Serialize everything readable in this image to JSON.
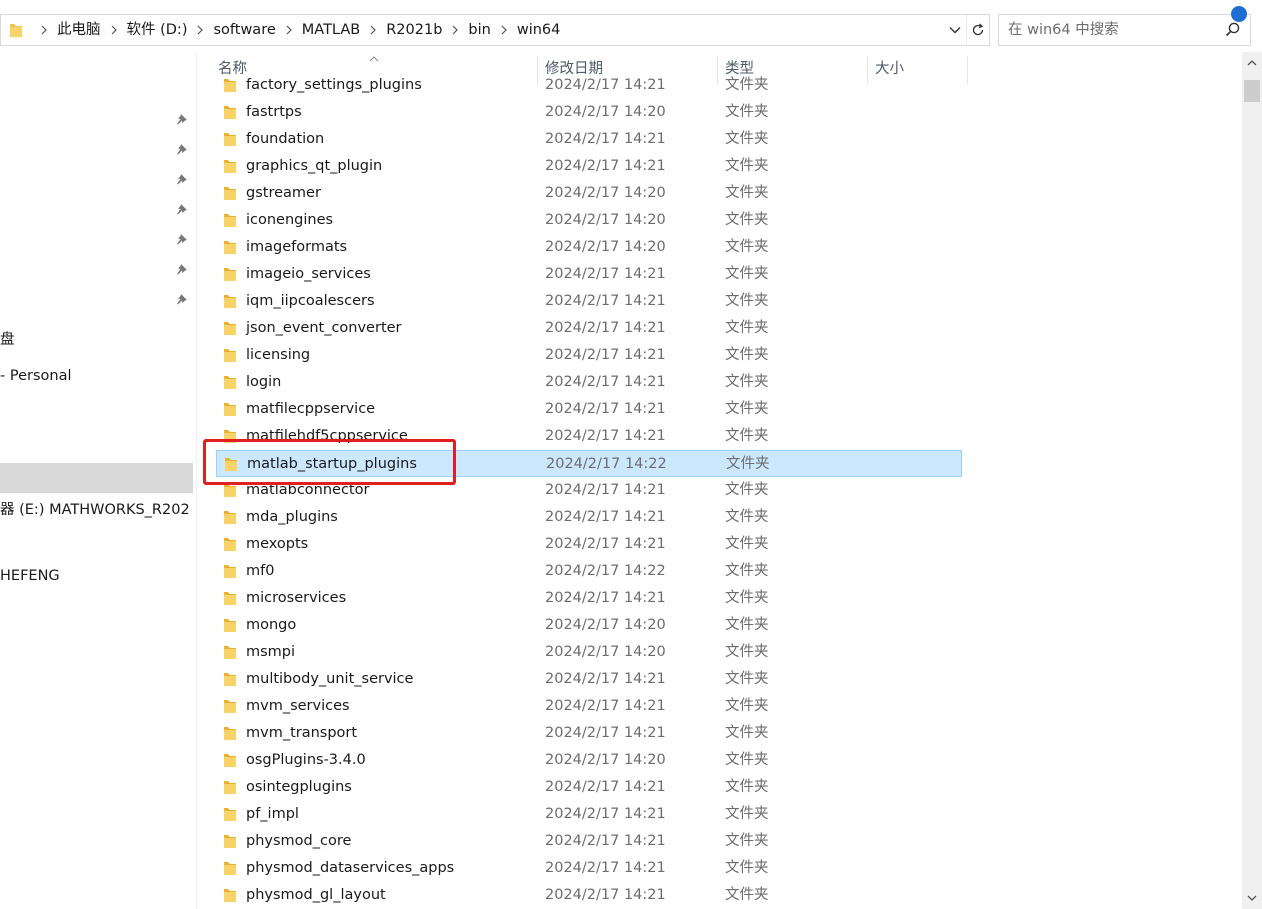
{
  "address_bar": {
    "breadcrumbs": [
      "此电脑",
      "软件 (D:)",
      "software",
      "MATLAB",
      "R2021b",
      "bin",
      "win64"
    ]
  },
  "search": {
    "placeholder": "在 win64 中搜索"
  },
  "nav_pane": {
    "labels": [
      "盘",
      "- Personal",
      "器 (E:) MATHWORKS_R202",
      "HEFENG"
    ]
  },
  "columns": {
    "name": "名称",
    "date": "修改日期",
    "type": "类型",
    "size": "大小"
  },
  "files": [
    {
      "name": "factory_settings_plugins",
      "date": "2024/2/17 14:21",
      "type": "文件夹"
    },
    {
      "name": "fastrtps",
      "date": "2024/2/17 14:20",
      "type": "文件夹"
    },
    {
      "name": "foundation",
      "date": "2024/2/17 14:21",
      "type": "文件夹"
    },
    {
      "name": "graphics_qt_plugin",
      "date": "2024/2/17 14:21",
      "type": "文件夹"
    },
    {
      "name": "gstreamer",
      "date": "2024/2/17 14:20",
      "type": "文件夹"
    },
    {
      "name": "iconengines",
      "date": "2024/2/17 14:20",
      "type": "文件夹"
    },
    {
      "name": "imageformats",
      "date": "2024/2/17 14:20",
      "type": "文件夹"
    },
    {
      "name": "imageio_services",
      "date": "2024/2/17 14:21",
      "type": "文件夹"
    },
    {
      "name": "iqm_iipcoalescers",
      "date": "2024/2/17 14:21",
      "type": "文件夹"
    },
    {
      "name": "json_event_converter",
      "date": "2024/2/17 14:21",
      "type": "文件夹"
    },
    {
      "name": "licensing",
      "date": "2024/2/17 14:21",
      "type": "文件夹"
    },
    {
      "name": "login",
      "date": "2024/2/17 14:21",
      "type": "文件夹"
    },
    {
      "name": "matfilecppservice",
      "date": "2024/2/17 14:21",
      "type": "文件夹"
    },
    {
      "name": "matfilehdf5cppservice",
      "date": "2024/2/17 14:21",
      "type": "文件夹"
    },
    {
      "name": "matlab_startup_plugins",
      "date": "2024/2/17 14:22",
      "type": "文件夹",
      "selected": true
    },
    {
      "name": "matlabconnector",
      "date": "2024/2/17 14:21",
      "type": "文件夹"
    },
    {
      "name": "mda_plugins",
      "date": "2024/2/17 14:21",
      "type": "文件夹"
    },
    {
      "name": "mexopts",
      "date": "2024/2/17 14:21",
      "type": "文件夹"
    },
    {
      "name": "mf0",
      "date": "2024/2/17 14:22",
      "type": "文件夹"
    },
    {
      "name": "microservices",
      "date": "2024/2/17 14:21",
      "type": "文件夹"
    },
    {
      "name": "mongo",
      "date": "2024/2/17 14:20",
      "type": "文件夹"
    },
    {
      "name": "msmpi",
      "date": "2024/2/17 14:20",
      "type": "文件夹"
    },
    {
      "name": "multibody_unit_service",
      "date": "2024/2/17 14:21",
      "type": "文件夹"
    },
    {
      "name": "mvm_services",
      "date": "2024/2/17 14:21",
      "type": "文件夹"
    },
    {
      "name": "mvm_transport",
      "date": "2024/2/17 14:21",
      "type": "文件夹"
    },
    {
      "name": "osgPlugins-3.4.0",
      "date": "2024/2/17 14:20",
      "type": "文件夹"
    },
    {
      "name": "osintegplugins",
      "date": "2024/2/17 14:21",
      "type": "文件夹"
    },
    {
      "name": "pf_impl",
      "date": "2024/2/17 14:21",
      "type": "文件夹"
    },
    {
      "name": "physmod_core",
      "date": "2024/2/17 14:21",
      "type": "文件夹"
    },
    {
      "name": "physmod_dataservices_apps",
      "date": "2024/2/17 14:21",
      "type": "文件夹"
    },
    {
      "name": "physmod_gl_layout",
      "date": "2024/2/17 14:21",
      "type": "文件夹"
    }
  ],
  "colors": {
    "selection": "#cce8ff",
    "selection_border": "#99d1ff",
    "annotation": "#e02020",
    "folder": "#f5c242"
  },
  "icons": {
    "folder": "folder-icon",
    "pin": "pin-icon",
    "search": "search-icon",
    "refresh": "refresh-icon"
  }
}
